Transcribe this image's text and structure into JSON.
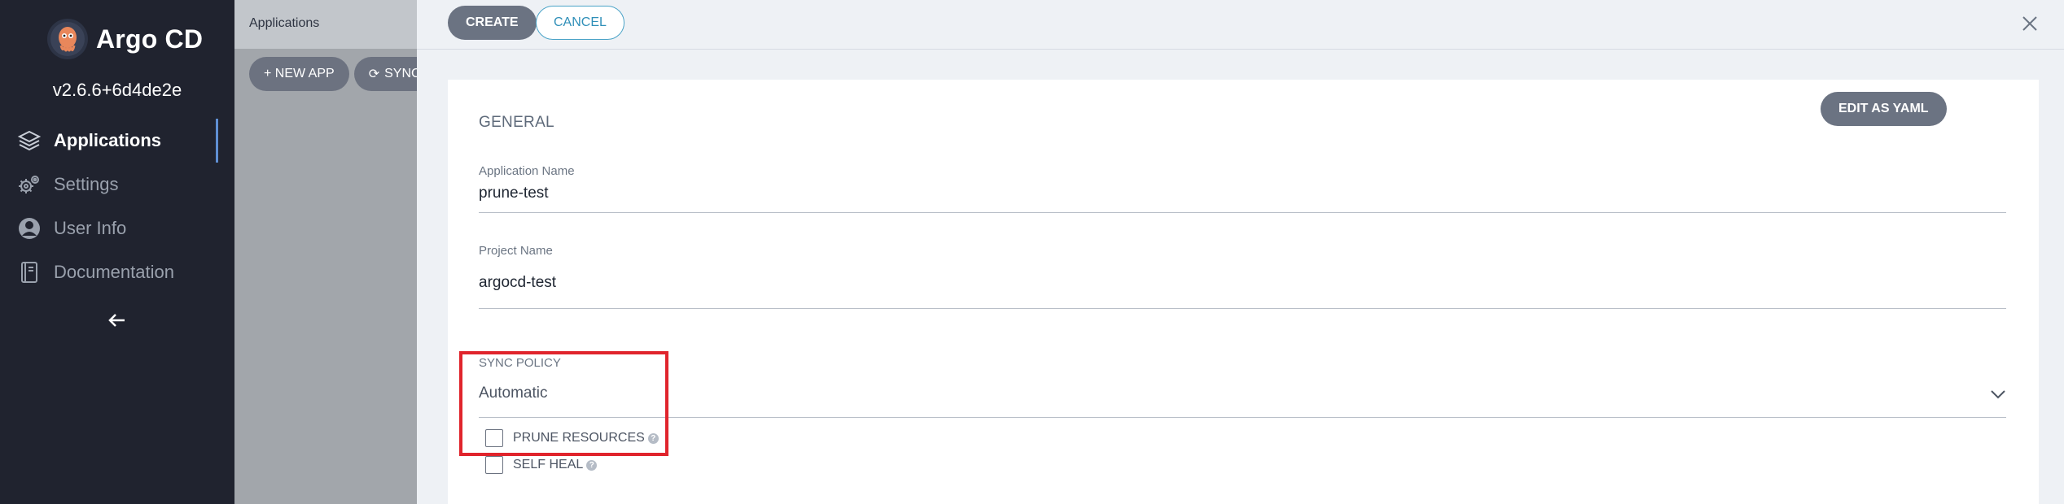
{
  "sidebar": {
    "app_name": "Argo CD",
    "version": "v2.6.6+6d4de2e",
    "items": [
      {
        "label": "Applications",
        "icon": "layers-icon",
        "active": true
      },
      {
        "label": "Settings",
        "icon": "gears-icon",
        "active": false
      },
      {
        "label": "User Info",
        "icon": "user-circle-icon",
        "active": false
      },
      {
        "label": "Documentation",
        "icon": "book-icon",
        "active": false
      }
    ],
    "collapse_icon": "arrow-left-icon"
  },
  "background": {
    "breadcrumb": "Applications",
    "new_app_label": "+ NEW APP",
    "sync_label": "SYNC"
  },
  "panel": {
    "create_label": "CREATE",
    "cancel_label": "CANCEL",
    "close_icon": "close-icon",
    "edit_yaml_label": "EDIT AS YAML",
    "section_title": "GENERAL",
    "application_name": {
      "label": "Application Name",
      "value": "prune-test"
    },
    "project_name": {
      "label": "Project Name",
      "value": "argocd-test"
    },
    "sync_policy": {
      "label": "SYNC POLICY",
      "value": "Automatic"
    },
    "prune_resources": {
      "label": "PRUNE RESOURCES",
      "checked": false
    },
    "self_heal": {
      "label": "SELF HEAL",
      "checked": false
    }
  },
  "colors": {
    "sidebar_bg": "#20232f",
    "accent": "#5f8fd3",
    "button_gray": "#6b7382",
    "cancel_blue": "#2f8fb8",
    "highlight_red": "#e0242c"
  }
}
